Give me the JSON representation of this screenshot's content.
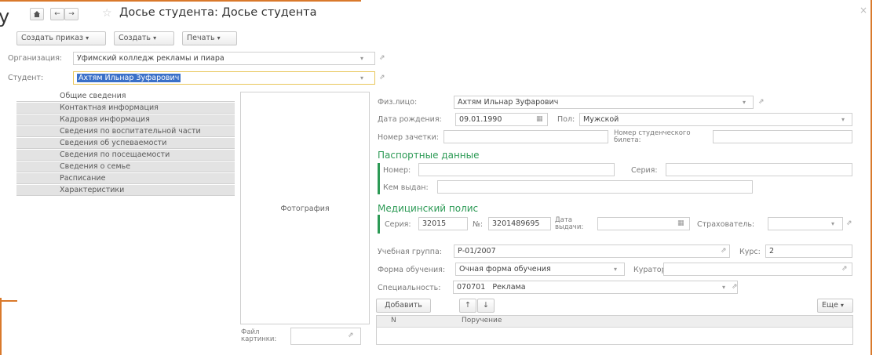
{
  "window": {
    "title": "Досье студента: Досье студента",
    "close_glyph": "×"
  },
  "icons": {
    "home": "home-icon",
    "back": "arrow-left-icon",
    "forward": "arrow-right-icon",
    "favorite": "star-icon",
    "link": "link-icon",
    "dropdown": "chevron-down-icon",
    "calendar": "calendar-icon",
    "up": "arrow-up-icon",
    "down": "arrow-down-icon"
  },
  "toolbar": {
    "create_order": "Создать приказ",
    "create": "Создать",
    "print": "Печать"
  },
  "header_fields": {
    "org_label": "Организация:",
    "org_value": "Уфимский колледж рекламы и пиара",
    "student_label": "Студент:",
    "student_value": "Ахтям Ильнар Зуфарович"
  },
  "sidebar": {
    "items": [
      {
        "label": "Общие сведения",
        "active": true
      },
      {
        "label": "Контактная информация",
        "active": false
      },
      {
        "label": "Кадровая информация",
        "active": false
      },
      {
        "label": "Сведения по воспитательной части",
        "active": false
      },
      {
        "label": "Сведения об успеваемости",
        "active": false
      },
      {
        "label": "Сведения по посещаемости",
        "active": false
      },
      {
        "label": "Сведения о семье",
        "active": false
      },
      {
        "label": "Расписание",
        "active": false
      },
      {
        "label": "Характеристики",
        "active": false
      }
    ]
  },
  "photo": {
    "caption": "Фотография",
    "file_label": "Файл картинки:"
  },
  "general": {
    "person_label": "Физ.лицо:",
    "person_value": "Ахтям Ильнар Зуфарович",
    "birth_label": "Дата рождения:",
    "birth_value": "09.01.1990",
    "gender_label": "Пол:",
    "gender_value": "Мужской",
    "recordbook_label": "Номер зачетки:",
    "recordbook_value": "",
    "studcard_label": "Номер студенческого билета:",
    "studcard_value": ""
  },
  "passport": {
    "title": "Паспортные данные",
    "number_label": "Номер:",
    "number_value": "",
    "series_label": "Серия:",
    "series_value": "",
    "issued_label": "Кем выдан:",
    "issued_value": ""
  },
  "medical": {
    "title": "Медицинский полис",
    "series_label": "Серия:",
    "series_value": "32015",
    "number_label": "№:",
    "number_value": "3201489695",
    "issue_date_label": "Дата выдачи:",
    "issue_date_value": "",
    "insurer_label": "Страхователь:",
    "insurer_value": ""
  },
  "study": {
    "group_label": "Учебная группа:",
    "group_value": "Р-01/2007",
    "course_label": "Курс:",
    "course_value": "2",
    "form_label": "Форма обучения:",
    "form_value": "Очная форма обучения",
    "curator_label": "Куратор:",
    "curator_value": "",
    "specialty_label": "Специальность:",
    "specialty_code": "070701",
    "specialty_name": "Реклама"
  },
  "table": {
    "add_button": "Добавить",
    "more_button": "Еще",
    "col_n": "N",
    "col_assignment": "Поручение"
  }
}
